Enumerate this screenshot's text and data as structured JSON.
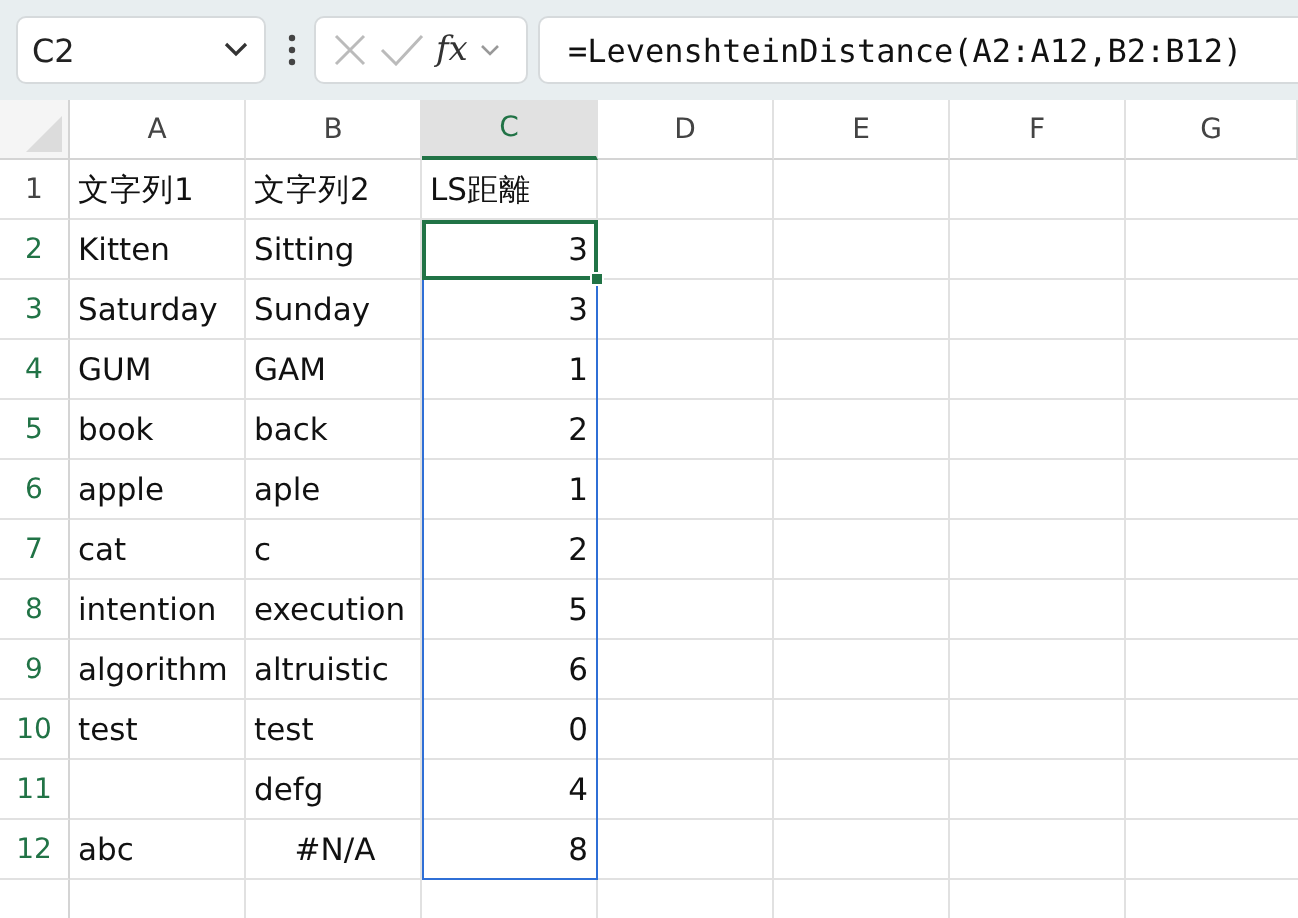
{
  "name_box": {
    "value": "C2"
  },
  "formula_bar": {
    "function_label": "fx",
    "formula": "=LevenshteinDistance(A2:A12,B2:B12)"
  },
  "columns": [
    {
      "label": "A",
      "selected": false
    },
    {
      "label": "B",
      "selected": false
    },
    {
      "label": "C",
      "selected": true
    },
    {
      "label": "D",
      "selected": false
    },
    {
      "label": "E",
      "selected": false
    },
    {
      "label": "F",
      "selected": false
    },
    {
      "label": "G",
      "selected": false
    }
  ],
  "rows": [
    {
      "label": "1",
      "selected": false,
      "cells": [
        {
          "kind": "text",
          "text": "文字列1",
          "selected": false,
          "active": false
        },
        {
          "kind": "text",
          "text": "文字列2",
          "selected": false,
          "active": false
        },
        {
          "kind": "text",
          "text": "LS距離",
          "selected": false,
          "active": false
        }
      ]
    },
    {
      "label": "2",
      "selected": true,
      "cells": [
        {
          "kind": "text",
          "text": "Kitten",
          "selected": false,
          "active": false
        },
        {
          "kind": "text",
          "text": "Sitting",
          "selected": false,
          "active": false
        },
        {
          "kind": "number",
          "text": "3",
          "active": true
        }
      ]
    },
    {
      "label": "3",
      "selected": true,
      "cells": [
        {
          "kind": "text",
          "text": "Saturday",
          "selected": false,
          "active": false
        },
        {
          "kind": "text",
          "text": "Sunday",
          "selected": false,
          "active": false
        },
        {
          "kind": "number",
          "text": "3",
          "selected": true,
          "active": false
        }
      ]
    },
    {
      "label": "4",
      "selected": true,
      "cells": [
        {
          "kind": "text",
          "text": "GUM",
          "selected": false,
          "active": false
        },
        {
          "kind": "text",
          "text": "GAM",
          "selected": false,
          "active": false
        },
        {
          "kind": "number",
          "text": "1",
          "selected": true,
          "active": false
        }
      ]
    },
    {
      "label": "5",
      "selected": true,
      "cells": [
        {
          "kind": "text",
          "text": "book",
          "selected": false,
          "active": false
        },
        {
          "kind": "text",
          "text": "back",
          "selected": false,
          "active": false
        },
        {
          "kind": "number",
          "text": "2",
          "selected": true,
          "active": false
        }
      ]
    },
    {
      "label": "6",
      "selected": true,
      "cells": [
        {
          "kind": "text",
          "text": "apple",
          "selected": false,
          "active": false
        },
        {
          "kind": "text",
          "text": "aple",
          "selected": false,
          "active": false
        },
        {
          "kind": "number",
          "text": "1",
          "selected": true,
          "active": false
        }
      ]
    },
    {
      "label": "7",
      "selected": true,
      "cells": [
        {
          "kind": "text",
          "text": "cat",
          "selected": false,
          "active": false
        },
        {
          "kind": "text",
          "text": "c",
          "selected": false,
          "active": false
        },
        {
          "kind": "number",
          "text": "2",
          "selected": true,
          "active": false
        }
      ]
    },
    {
      "label": "8",
      "selected": true,
      "cells": [
        {
          "kind": "text",
          "text": "intention",
          "selected": false,
          "active": false
        },
        {
          "kind": "text",
          "text": "execution",
          "selected": false,
          "active": false
        },
        {
          "kind": "number",
          "text": "5",
          "selected": true,
          "active": false
        }
      ]
    },
    {
      "label": "9",
      "selected": true,
      "cells": [
        {
          "kind": "text",
          "text": "algorithm",
          "selected": false,
          "active": false
        },
        {
          "kind": "text",
          "text": "altruistic",
          "selected": false,
          "active": false
        },
        {
          "kind": "number",
          "text": "6",
          "selected": true,
          "active": false
        }
      ]
    },
    {
      "label": "10",
      "selected": true,
      "cells": [
        {
          "kind": "text",
          "text": "test",
          "selected": false,
          "active": false
        },
        {
          "kind": "text",
          "text": "test",
          "selected": false,
          "active": false
        },
        {
          "kind": "number",
          "text": "0",
          "selected": true,
          "active": false
        }
      ]
    },
    {
      "label": "11",
      "selected": true,
      "cells": [
        {
          "kind": "empty"
        },
        {
          "kind": "text",
          "text": "defg",
          "selected": false,
          "active": false
        },
        {
          "kind": "number",
          "text": "4",
          "selected": true,
          "active": false
        }
      ]
    },
    {
      "label": "12",
      "selected": true,
      "cells": [
        {
          "kind": "text",
          "text": "abc",
          "selected": false,
          "active": false
        },
        {
          "kind": "error",
          "text": "#N/A",
          "selected": false,
          "active": false
        },
        {
          "kind": "number",
          "text": "8",
          "selected": true,
          "active": false
        }
      ]
    }
  ]
}
